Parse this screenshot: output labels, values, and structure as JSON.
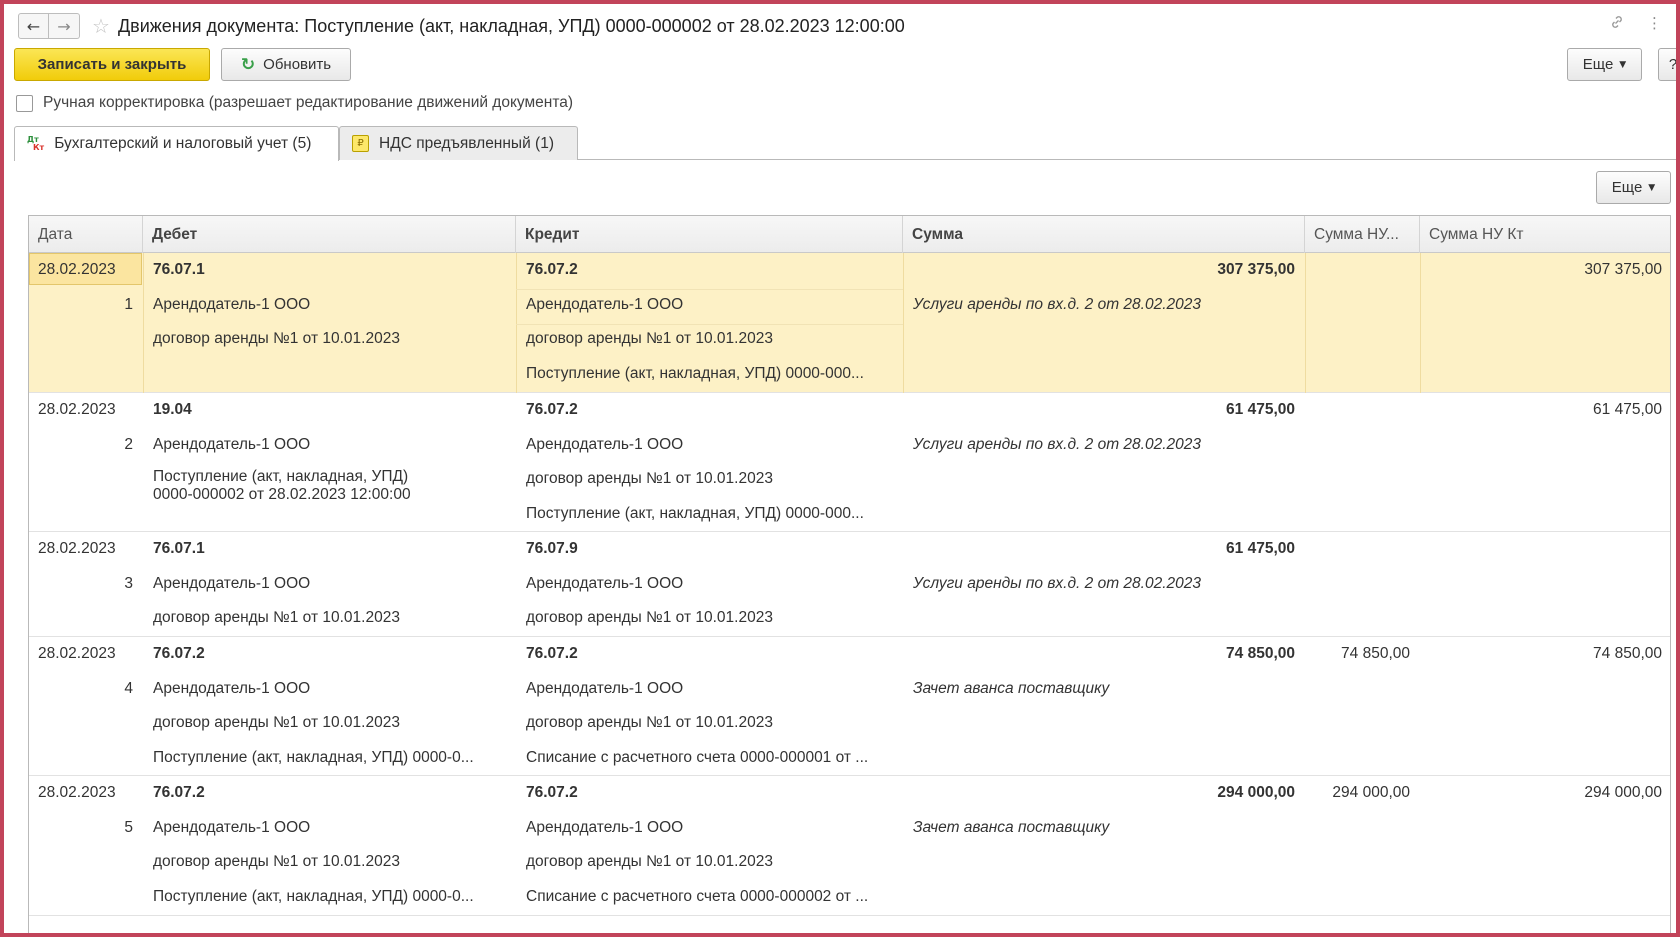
{
  "window": {
    "title": "Движения документа: Поступление (акт, накладная, УПД) 0000-000002 от 28.02.2023 12:00:00",
    "back_icon": "←",
    "forward_icon": "→",
    "favorite_icon": "☆",
    "link_icon": "🔗",
    "menu_icon": "⋮"
  },
  "toolbar": {
    "save_close_label": "Записать и закрыть",
    "refresh_label": "Обновить",
    "refresh_icon": "↻",
    "more_label": "Еще",
    "help_label": "?",
    "caret": "▼"
  },
  "manual_edit": {
    "label": "Ручная корректировка (разрешает редактирование движений документа)",
    "checked": false
  },
  "tabs": [
    {
      "label": "Бухгалтерский и налоговый учет (5)",
      "icon_dt": "Дт",
      "icon_kt": "Кт",
      "active": true
    },
    {
      "label": "НДС предъявленный (1)",
      "icon": "₽",
      "active": false
    }
  ],
  "grid_more_label": "Еще",
  "columns": [
    "Дата",
    "Дебет",
    "Кредит",
    "Сумма",
    "Сумма НУ...",
    "Сумма НУ Кт"
  ],
  "rows": [
    {
      "date": "28.02.2023",
      "num": "1",
      "debit": [
        "76.07.1",
        "Арендодатель-1 ООО",
        "договор аренды №1 от 10.01.2023"
      ],
      "credit": [
        "76.07.2",
        "Арендодатель-1 ООО",
        "договор аренды №1 от 10.01.2023",
        "Поступление (акт, накладная, УПД) 0000-000..."
      ],
      "sum": "307 375,00",
      "content": "Услуги аренды по вх.д. 2 от 28.02.2023",
      "sum_nu_dt": "",
      "sum_nu_kt": "307 375,00"
    },
    {
      "date": "28.02.2023",
      "num": "2",
      "debit": [
        "19.04",
        "Арендодатель-1 ООО",
        "Поступление (акт, накладная, УПД)",
        "0000-000002 от 28.02.2023 12:00:00"
      ],
      "credit": [
        "76.07.2",
        "Арендодатель-1 ООО",
        "договор аренды №1 от 10.01.2023",
        "Поступление (акт, накладная, УПД) 0000-000..."
      ],
      "sum": "61 475,00",
      "content": "Услуги аренды по вх.д. 2 от 28.02.2023",
      "sum_nu_dt": "",
      "sum_nu_kt": "61 475,00"
    },
    {
      "date": "28.02.2023",
      "num": "3",
      "debit": [
        "76.07.1",
        "Арендодатель-1 ООО",
        "договор аренды №1 от 10.01.2023"
      ],
      "credit": [
        "76.07.9",
        "Арендодатель-1 ООО",
        "договор аренды №1 от 10.01.2023"
      ],
      "sum": "61 475,00",
      "content": "Услуги аренды по вх.д. 2 от 28.02.2023",
      "sum_nu_dt": "",
      "sum_nu_kt": ""
    },
    {
      "date": "28.02.2023",
      "num": "4",
      "debit": [
        "76.07.2",
        "Арендодатель-1 ООО",
        "договор аренды №1 от 10.01.2023",
        "Поступление (акт, накладная, УПД) 0000-0..."
      ],
      "credit": [
        "76.07.2",
        "Арендодатель-1 ООО",
        "договор аренды №1 от 10.01.2023",
        "Списание с расчетного счета 0000-000001 от ..."
      ],
      "sum": "74 850,00",
      "content": "Зачет аванса поставщику",
      "sum_nu_dt": "74 850,00",
      "sum_nu_kt": "74 850,00"
    },
    {
      "date": "28.02.2023",
      "num": "5",
      "debit": [
        "76.07.2",
        "Арендодатель-1 ООО",
        "договор аренды №1 от 10.01.2023",
        "Поступление (акт, накладная, УПД) 0000-0..."
      ],
      "credit": [
        "76.07.2",
        "Арендодатель-1 ООО",
        "договор аренды №1 от 10.01.2023",
        "Списание с расчетного счета 0000-000002 от ..."
      ],
      "sum": "294 000,00",
      "content": "Зачет аванса поставщику",
      "sum_nu_dt": "294 000,00",
      "sum_nu_kt": "294 000,00"
    }
  ]
}
